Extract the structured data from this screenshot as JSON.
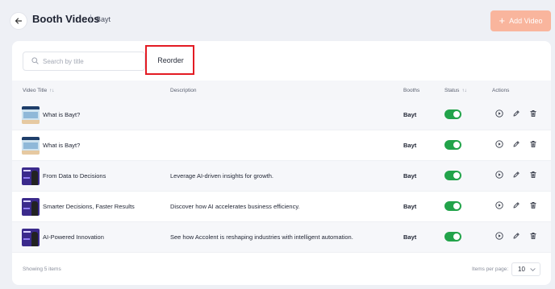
{
  "header": {
    "title": "Booth Videos",
    "separator": "|",
    "subtitle": "Bayt",
    "add_button_label": "Add Video",
    "add_button_icon": "+"
  },
  "toolbar": {
    "search_placeholder": "Search by title",
    "search_value": "",
    "reorder_label": "Reorder"
  },
  "table": {
    "columns": {
      "title": "Video Title",
      "description": "Description",
      "booths": "Booths",
      "status": "Status",
      "actions": "Actions"
    },
    "sort_indicator": "↑↓",
    "rows": [
      {
        "title": "What is Bayt?",
        "description": "",
        "booth": "Bayt",
        "status": true,
        "thumb": "classroom"
      },
      {
        "title": "What is Bayt?",
        "description": "",
        "booth": "Bayt",
        "status": true,
        "thumb": "classroom"
      },
      {
        "title": "From Data to Decisions",
        "description": "Leverage AI-driven insights for growth.",
        "booth": "Bayt",
        "status": true,
        "thumb": "purple"
      },
      {
        "title": "Smarter Decisions, Faster Results",
        "description": "Discover how AI accelerates business efficiency.",
        "booth": "Bayt",
        "status": true,
        "thumb": "purple"
      },
      {
        "title": "AI-Powered Innovation",
        "description": "See how Accolent is reshaping industries with intelligent automation.",
        "booth": "Bayt",
        "status": true,
        "thumb": "purple"
      }
    ]
  },
  "footer": {
    "showing_text": "Showing 5 items",
    "items_per_page_label": "Items per page:",
    "items_per_page_value": "10"
  },
  "colors": {
    "accent": "#f9b59d",
    "toggle_on": "#22a34a",
    "highlight": "#e31b23",
    "background": "#eef0f5"
  },
  "icons": {
    "back": "arrow-left-icon",
    "search": "search-icon",
    "play": "play-circle-icon",
    "edit": "pencil-icon",
    "delete": "trash-icon",
    "dropdown": "chevron-down-icon",
    "sort": "sort-icon"
  }
}
